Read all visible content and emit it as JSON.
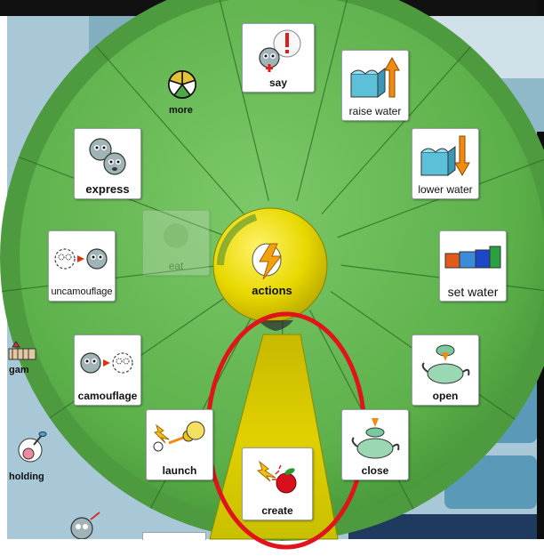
{
  "wheel": {
    "center": {
      "label": "actions",
      "icon": "lightning-bolt-icon"
    },
    "items": [
      {
        "id": "more",
        "label": "more",
        "icon": "pie-menu-icon"
      },
      {
        "id": "say",
        "label": "say",
        "icon": "speech-bubble-icon"
      },
      {
        "id": "raise_water",
        "label": "raise water",
        "icon": "water-up-arrow-icon"
      },
      {
        "id": "lower_water",
        "label": "lower water",
        "icon": "water-down-arrow-icon"
      },
      {
        "id": "set_water",
        "label": "set water",
        "icon": "colored-cubes-icon"
      },
      {
        "id": "open",
        "label": "open",
        "icon": "teapot-open-icon"
      },
      {
        "id": "close",
        "label": "close",
        "icon": "teapot-close-icon"
      },
      {
        "id": "create",
        "label": "create",
        "icon": "sparkle-apple-icon"
      },
      {
        "id": "launch",
        "label": "launch",
        "icon": "launch-icon"
      },
      {
        "id": "camouflage",
        "label": "camouflage",
        "icon": "camouflage-icon"
      },
      {
        "id": "uncamouflage",
        "label": "uncamouflage",
        "icon": "uncamouflage-icon"
      },
      {
        "id": "express",
        "label": "express",
        "icon": "two-faces-icon"
      }
    ],
    "faded_items": [
      {
        "label": "eat",
        "icon": "eat-icon"
      }
    ],
    "selected": "create"
  },
  "outer_ring": {
    "items": [
      {
        "label": "gam",
        "icon": "game-board-icon"
      },
      {
        "label": "holding",
        "icon": "ice-cream-icon"
      }
    ]
  },
  "colors": {
    "wheel_green": "#5cb04a",
    "wheel_dark_green": "#3d8a30",
    "center_yellow": "#e0d000",
    "highlight_red": "#e0141a",
    "background_blue": "#a8c8d8"
  }
}
